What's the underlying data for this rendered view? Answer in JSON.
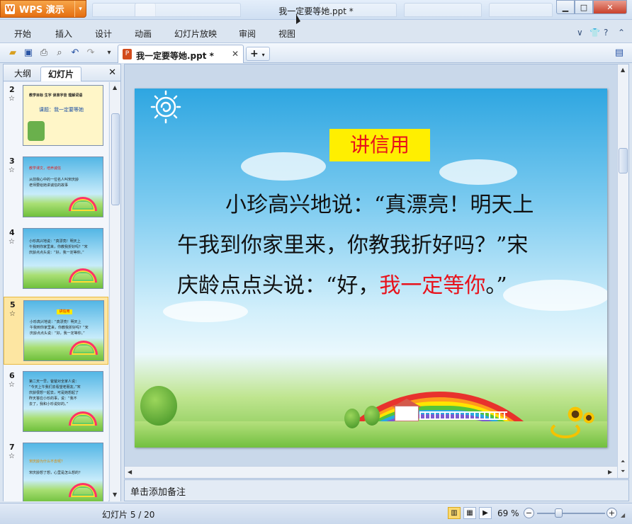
{
  "app": {
    "name": "WPS 演示",
    "logo": "W"
  },
  "window": {
    "title": "我一定要等她.ppt *"
  },
  "menu": [
    "开始",
    "插入",
    "设计",
    "动画",
    "幻灯片放映",
    "审阅",
    "视图"
  ],
  "doc_tab": {
    "label": "我一定要等她.ppt *",
    "icon": "P"
  },
  "left_panel": {
    "tabs": [
      "大纲",
      "幻灯片"
    ],
    "active_tab": "幻灯片",
    "thumbnails": [
      {
        "num": "2",
        "style": "yellow",
        "lines": [
          "教学目标  生字 读准字音 理解词语",
          "课题：我一定要等她"
        ]
      },
      {
        "num": "3",
        "style": "sky",
        "lines": [
          "教学课文，培养诚信",
          "从前我心中的一位名人叫宋庆龄",
          "老师要给她讲诚信的故事"
        ]
      },
      {
        "num": "4",
        "style": "sky",
        "lines": [
          "小珍高兴地说：“真漂亮！明天上",
          "午我到你家里来，你教我折好吗？”宋",
          "庆龄点点头说：“好，我一定等你。”"
        ]
      },
      {
        "num": "5",
        "style": "sky",
        "lines": [
          "小珍高兴地说：“真漂亮！明天上",
          "午我到你家里来，你教我折好吗？”宋",
          "庆龄点点头说：“好，我一定等你。”"
        ]
      },
      {
        "num": "6",
        "style": "sky",
        "lines": [
          "第二天一早，爸爸对全家人说：",
          "“今天上午我们去看望老朋友。”宋",
          "庆龄很想一起去，可是她想起了",
          "昨天答应小珍的事，说：“我不",
          "去了，我和小珍说好的。”"
        ]
      },
      {
        "num": "7",
        "style": "sky",
        "lines": [
          "宋庆龄为什么不去呢？",
          "宋庆龄想了想，心里是怎么想的？"
        ]
      }
    ],
    "selected_index": 3,
    "selected_title": "讲信用"
  },
  "slide": {
    "title": "讲信用",
    "body_line1": "小珍高兴地说：“真漂亮！明天上",
    "body_line2": "午我到你家里来，你教我折好吗？”宋",
    "body_line3_prefix": "庆龄点点头说：“好，",
    "body_line3_red": "我一定等你",
    "body_line3_suffix": "。”"
  },
  "notes": {
    "placeholder": "单击添加备注"
  },
  "status": {
    "slide_info": "幻灯片 5 / 20",
    "zoom": "69 %",
    "zoom_minus": "−",
    "zoom_plus": "+"
  },
  "colors": {
    "title_highlight": "#ffef00",
    "title_text": "#e8121b",
    "app_button": "#f0861e"
  }
}
